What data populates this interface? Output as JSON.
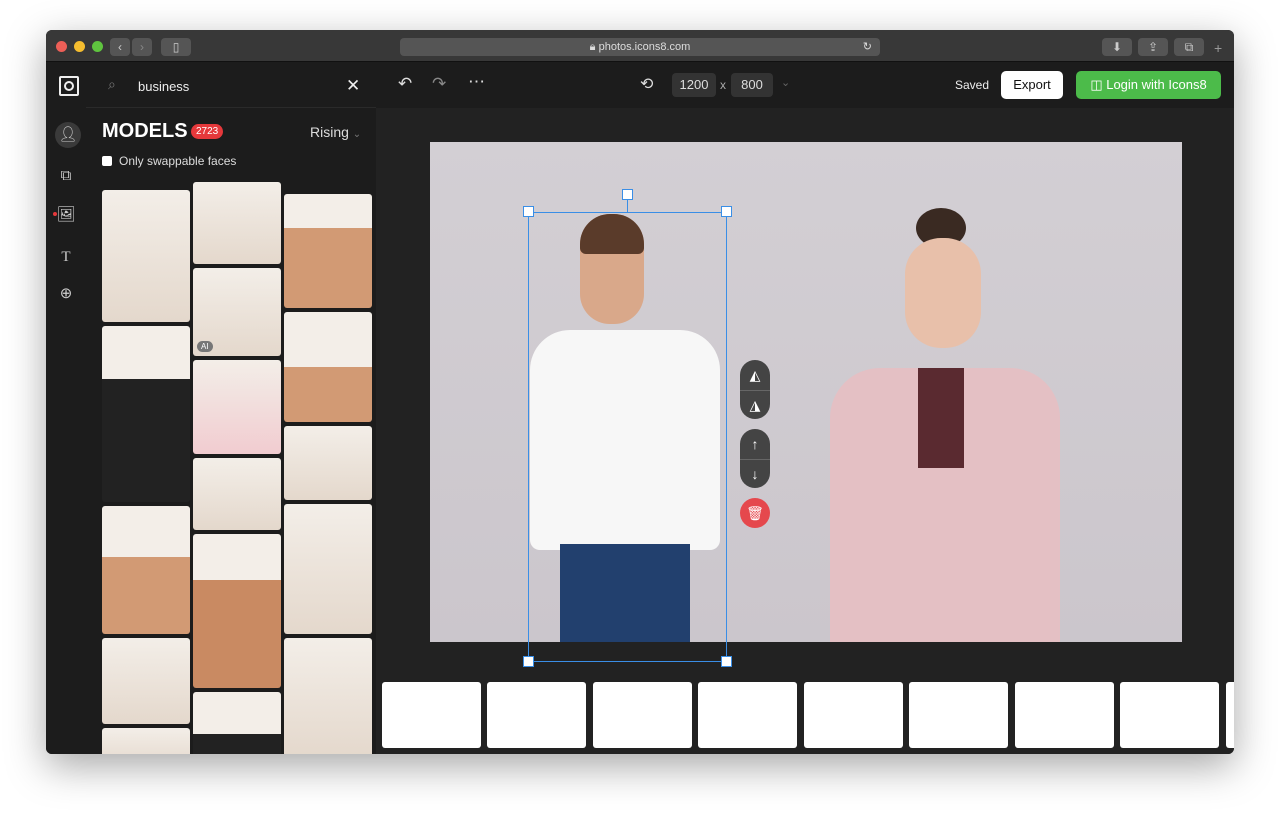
{
  "browser": {
    "url": "photos.icons8.com"
  },
  "search": {
    "value": "business"
  },
  "panel": {
    "title": "MODELS",
    "count": "2723",
    "sort": "Rising",
    "checkbox_label": "Only swappable faces",
    "ai_badge": "AI"
  },
  "toolbar": {
    "width": "1200",
    "x": "x",
    "height": "800",
    "saved": "Saved",
    "export": "Export",
    "login": "Login with Icons8"
  },
  "colors": {
    "accent_green": "#4cbb4a",
    "badge_red": "#e5383b"
  }
}
